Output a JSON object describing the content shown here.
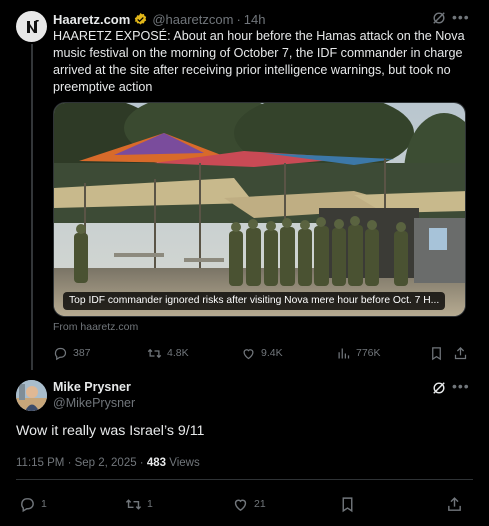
{
  "parent_tweet": {
    "author_name": "Haaretz.com",
    "handle": "@haaretzcom",
    "separator": "·",
    "time": "14h",
    "text": "HAARETZ EXPOSÉ: About an hour before the Hamas attack on the Nova music festival on the morning of October 7, the IDF commander in charge arrived at the site after receiving prior intelligence warnings, but took no preemptive action",
    "media_caption": "Top IDF commander ignored risks after visiting Nova mere hour before Oct. 7 H...",
    "source": "From haaretz.com",
    "actions": {
      "replies": "387",
      "reposts": "4.8K",
      "likes": "9.4K",
      "views": "776K"
    },
    "icons": [
      "haaretz-logo-icon",
      "verified-gold-icon",
      "grok-icon",
      "more-icon"
    ]
  },
  "main_tweet": {
    "author_name": "Mike Prysner",
    "handle": "@MikePrysner",
    "text": "Wow it really was Israel’s 9/11",
    "timestamp": "11:15 PM · Sep 2, 2025 · ",
    "views_count": "483",
    "views_label": " Views",
    "actions": {
      "replies": "1",
      "reposts": "1",
      "likes": "21"
    }
  },
  "colors": {
    "background": "#000000",
    "text": "#e7e9ea",
    "muted": "#71767b",
    "border": "#2f3336",
    "verified_gold": "#e2b719"
  }
}
